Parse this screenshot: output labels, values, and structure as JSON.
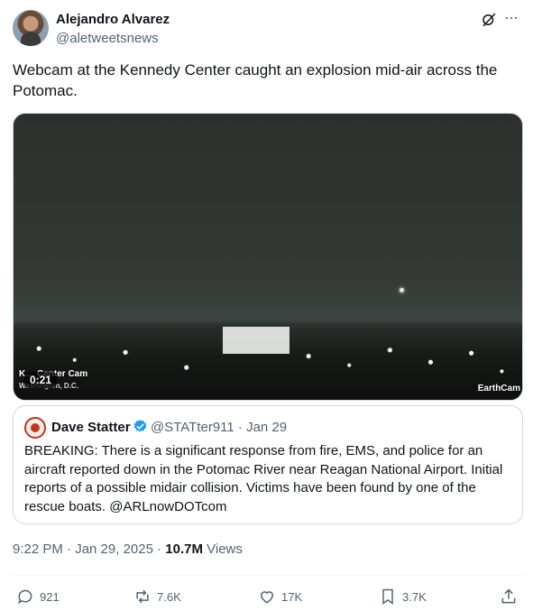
{
  "author": {
    "name": "Alejandro Alvarez",
    "handle": "@aletweetsnews"
  },
  "icons": {
    "grok": "grok-icon",
    "more": "more-icon"
  },
  "more_glyph": "···",
  "tweet": {
    "text": "Webcam at the Kennedy Center caught an explosion mid-air across the Potomac."
  },
  "media": {
    "cam_label": "K… Center Cam",
    "cam_sub": "Washington, D.C.",
    "duration": "0:21",
    "watermark": "EarthCam"
  },
  "quote": {
    "name": "Dave Statter",
    "handle_date": "@STATter911 · Jan 29",
    "text": "BREAKING: There is a significant response from fire, EMS, and police  for an aircraft reported down in the Potomac River near Reagan National Airport. Initial reports of a possible midair collision. Victims have been found by one of the rescue boats. @ARLnowDOTcom",
    "verified_color": "#1d9bf0"
  },
  "meta": {
    "timestamp": "9:22 PM · Jan 29, 2025 · ",
    "views_count": "10.7M",
    "views_label": " Views"
  },
  "actions": {
    "replies": "921",
    "reposts": "7.6K",
    "likes": "17K",
    "bookmarks": "3.7K"
  }
}
